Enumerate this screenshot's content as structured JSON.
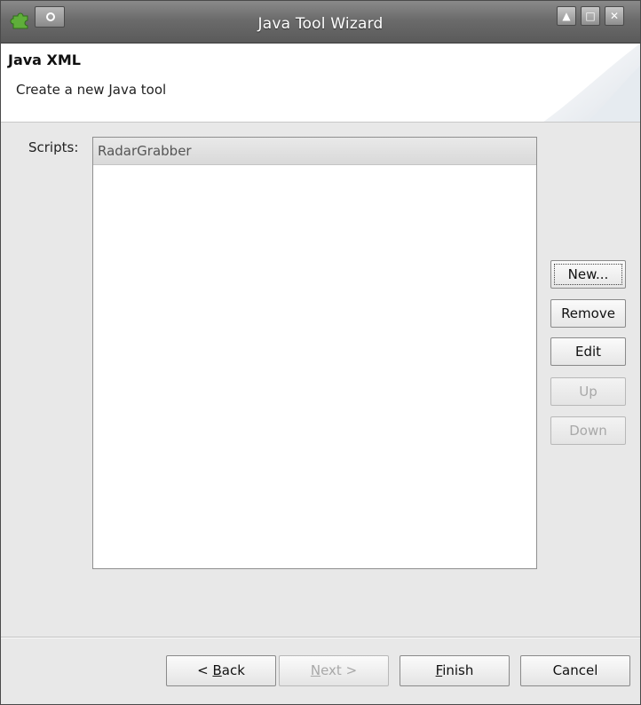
{
  "window": {
    "title": "Java Tool Wizard",
    "controls": [
      "up-arrow-icon",
      "maximize-icon",
      "close-icon"
    ]
  },
  "banner": {
    "title": "Java XML",
    "description": "Create a new Java tool"
  },
  "scripts": {
    "label": "Scripts:",
    "items": [
      "RadarGrabber"
    ]
  },
  "side_buttons": {
    "new": "New...",
    "remove": "Remove",
    "edit": "Edit",
    "up": "Up",
    "down": "Down"
  },
  "footer": {
    "back_prefix": "< ",
    "back_mnemonic": "B",
    "back_rest": "ack",
    "next_mnemonic": "N",
    "next_rest": "ext >",
    "finish_mnemonic": "F",
    "finish_rest": "inish",
    "cancel": "Cancel"
  },
  "colors": {
    "titlebar": "#6b6b6b",
    "app_icon": "#5fae3a",
    "disabled_text": "#a8a8a8"
  }
}
